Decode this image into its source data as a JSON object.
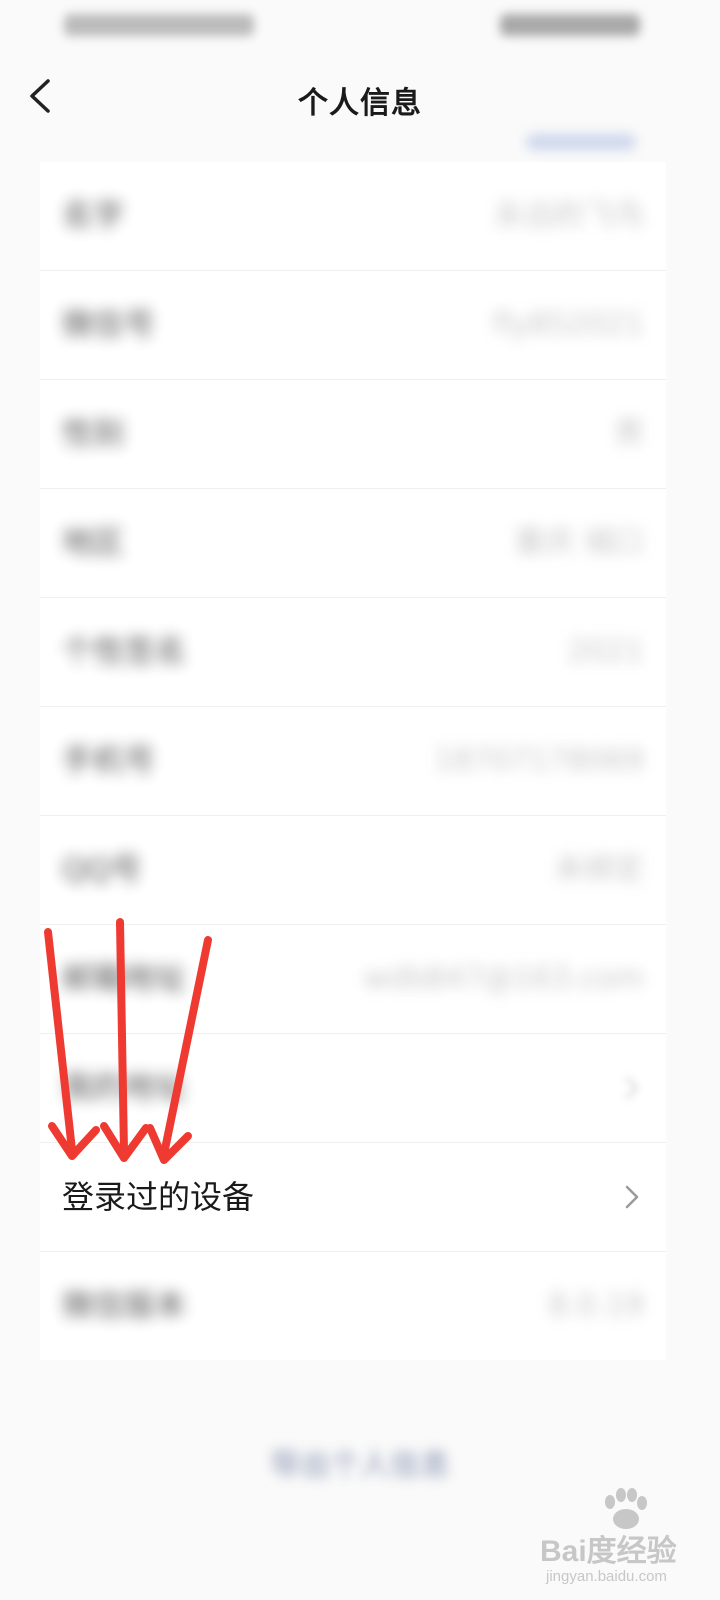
{
  "header": {
    "title": "个人信息"
  },
  "list": {
    "rows": [
      {
        "label": "名字",
        "value": "永远的飞鸟"
      },
      {
        "label": "微信号",
        "value": "fly852021"
      },
      {
        "label": "性别",
        "value": "男"
      },
      {
        "label": "地区",
        "value": "重庆 城口"
      },
      {
        "label": "个性签名",
        "value": "2021"
      },
      {
        "label": "手机号",
        "value": "18707178069"
      },
      {
        "label": "QQ号",
        "value": "未绑定"
      },
      {
        "label": "邮箱地址",
        "value": "wdb847@163.com"
      },
      {
        "label": "我的地址",
        "value": ""
      },
      {
        "label": "登录过的设备",
        "value": ""
      },
      {
        "label": "微信版本",
        "value": "8.0.19"
      }
    ]
  },
  "footer": {
    "export_label": "导出个人信息"
  },
  "watermark": {
    "main": "Bai度经验",
    "sub": "jingyan.baidu.com"
  },
  "colors": {
    "annotation_arrow": "#ee3a31",
    "chevron": "#9a9a9a",
    "link": "#5b6b95"
  },
  "icons": {
    "back": "chevron-left-icon",
    "row_arrow": "chevron-right-icon",
    "logo": "paw-icon"
  }
}
